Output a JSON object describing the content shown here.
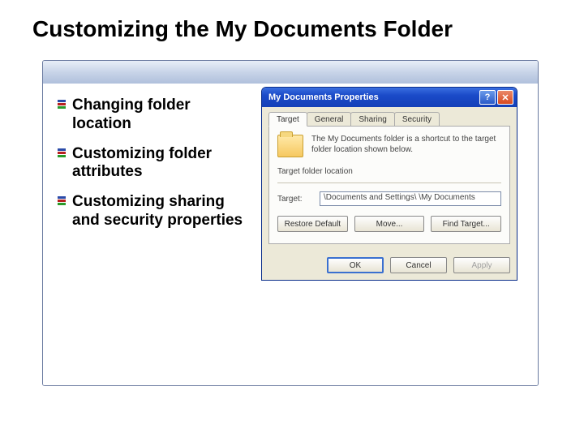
{
  "slide": {
    "title": "Customizing the My Documents Folder",
    "bullets": [
      "Changing folder location",
      "Customizing folder attributes",
      "Customizing sharing and security properties"
    ]
  },
  "dialog": {
    "title": "My Documents Properties",
    "help_glyph": "?",
    "close_glyph": "✕",
    "tabs": [
      "Target",
      "General",
      "Sharing",
      "Security"
    ],
    "active_tab": "Target",
    "description": "The My Documents folder is a shortcut to the target folder location shown below.",
    "group_label": "Target folder location",
    "target_label": "Target:",
    "target_value": "\\Documents and Settings\\        \\My Documents",
    "buttons": {
      "restore": "Restore Default",
      "move": "Move...",
      "find": "Find Target..."
    },
    "footer": {
      "ok": "OK",
      "cancel": "Cancel",
      "apply": "Apply"
    }
  }
}
